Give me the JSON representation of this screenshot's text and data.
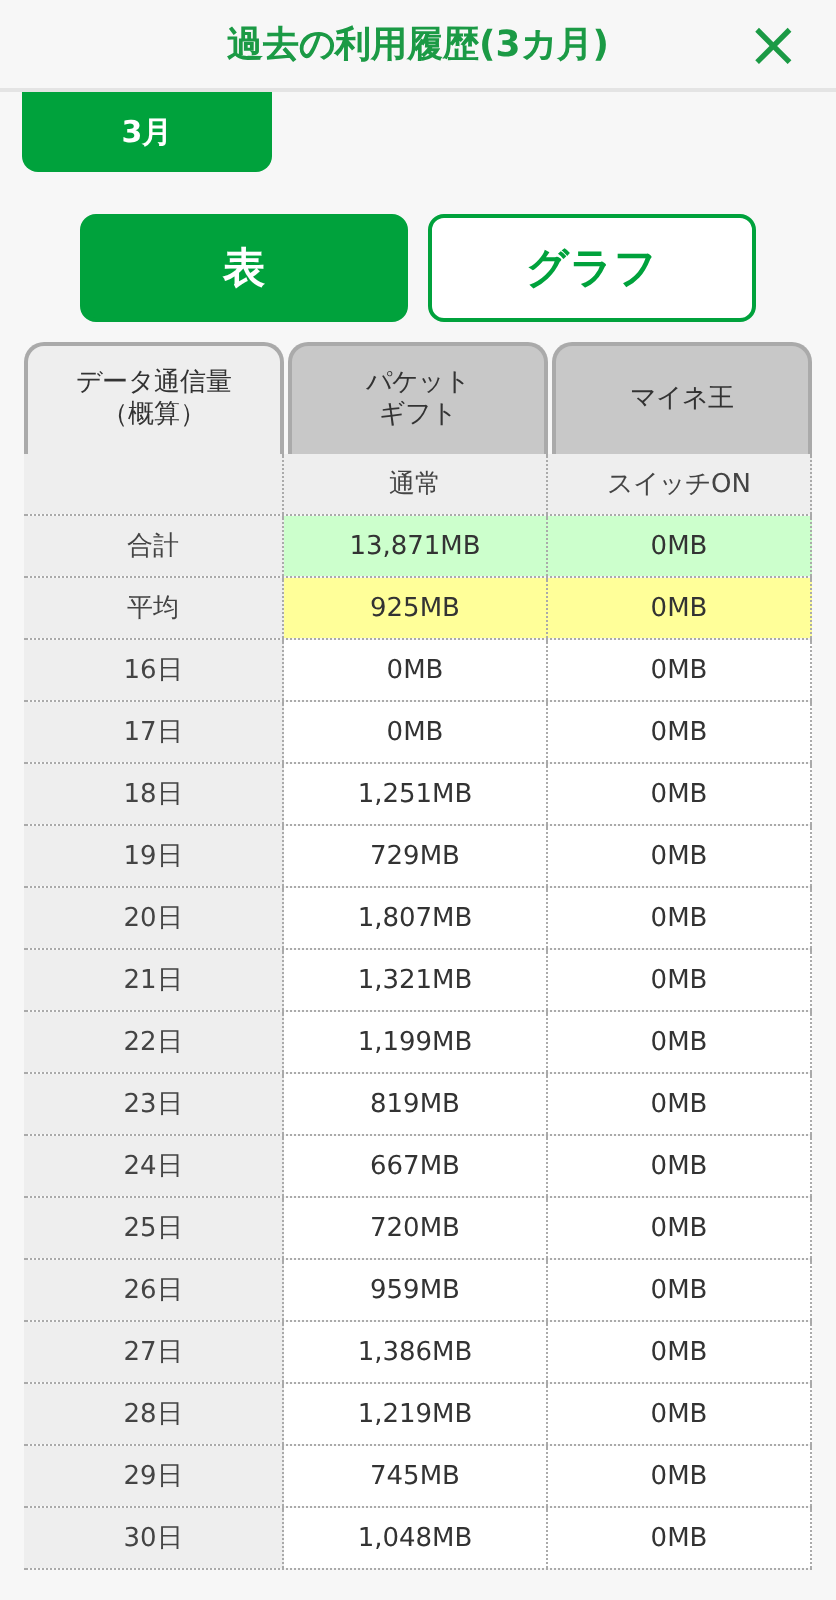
{
  "header": {
    "title": "過去の利用履歴(3カ月)",
    "close": "×"
  },
  "month_tab": "3月",
  "view_toggle": [
    {
      "label": "表",
      "selected": true
    },
    {
      "label": "グラフ",
      "selected": false
    }
  ],
  "table": {
    "tabs": [
      {
        "lines": [
          "データ通信量",
          "（概算）"
        ],
        "selected": true
      },
      {
        "lines": [
          "パケット",
          "ギフト"
        ],
        "selected": false
      },
      {
        "lines": [
          "マイネ王"
        ],
        "selected": false
      }
    ],
    "subheader": [
      "通常",
      "スイッチON"
    ],
    "rows": [
      {
        "kind": "total",
        "label": "合計",
        "cells": [
          "13,871MB",
          "0MB"
        ]
      },
      {
        "kind": "average",
        "label": "平均",
        "cells": [
          "925MB",
          "0MB"
        ]
      },
      {
        "kind": "day",
        "label": "16日",
        "cells": [
          "0MB",
          "0MB"
        ]
      },
      {
        "kind": "day",
        "label": "17日",
        "cells": [
          "0MB",
          "0MB"
        ]
      },
      {
        "kind": "day",
        "label": "18日",
        "cells": [
          "1,251MB",
          "0MB"
        ]
      },
      {
        "kind": "day",
        "label": "19日",
        "cells": [
          "729MB",
          "0MB"
        ]
      },
      {
        "kind": "day",
        "label": "20日",
        "cells": [
          "1,807MB",
          "0MB"
        ]
      },
      {
        "kind": "day",
        "label": "21日",
        "cells": [
          "1,321MB",
          "0MB"
        ]
      },
      {
        "kind": "day",
        "label": "22日",
        "cells": [
          "1,199MB",
          "0MB"
        ]
      },
      {
        "kind": "day",
        "label": "23日",
        "cells": [
          "819MB",
          "0MB"
        ]
      },
      {
        "kind": "day",
        "label": "24日",
        "cells": [
          "667MB",
          "0MB"
        ]
      },
      {
        "kind": "day",
        "label": "25日",
        "cells": [
          "720MB",
          "0MB"
        ]
      },
      {
        "kind": "day",
        "label": "26日",
        "cells": [
          "959MB",
          "0MB"
        ]
      },
      {
        "kind": "day",
        "label": "27日",
        "cells": [
          "1,386MB",
          "0MB"
        ]
      },
      {
        "kind": "day",
        "label": "28日",
        "cells": [
          "1,219MB",
          "0MB"
        ]
      },
      {
        "kind": "day",
        "label": "29日",
        "cells": [
          "745MB",
          "0MB"
        ]
      },
      {
        "kind": "day",
        "label": "30日",
        "cells": [
          "1,048MB",
          "0MB"
        ]
      }
    ]
  }
}
